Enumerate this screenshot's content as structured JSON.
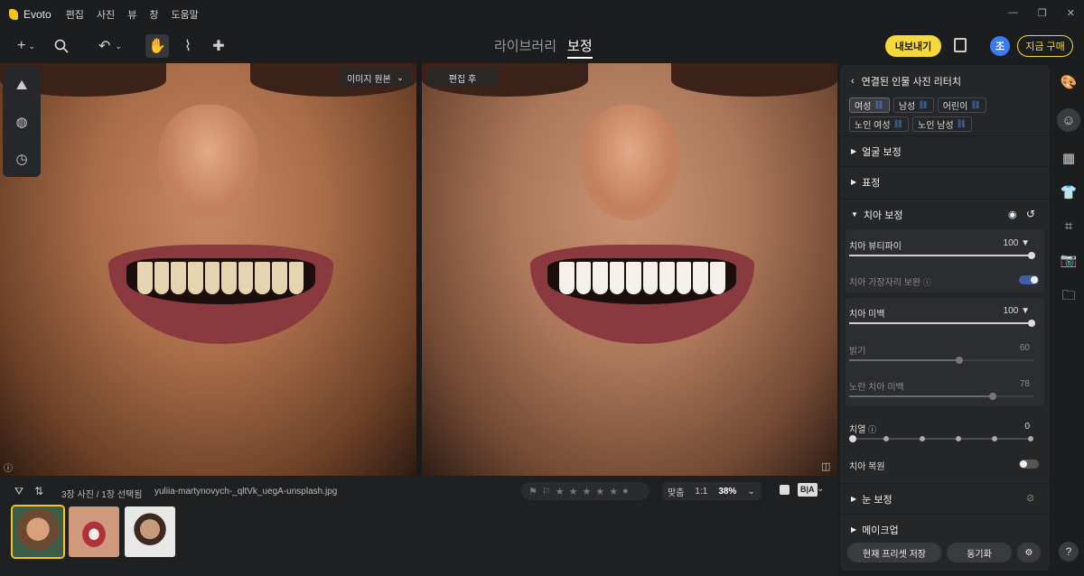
{
  "app": {
    "name": "Evoto"
  },
  "menu": [
    "편집",
    "사진",
    "뷰",
    "창",
    "도움말"
  ],
  "toolbar": {
    "tabs": [
      {
        "label": "라이브러리",
        "active": false
      },
      {
        "label": "보정",
        "active": true
      }
    ],
    "export_label": "내보내기",
    "avatar_letter": "조",
    "buy_label": "지금 구매"
  },
  "canvas": {
    "left_tag": "이미지 원본",
    "right_tag": "편집 후"
  },
  "filmstrip": {
    "count_text": "3장 사진 / 1장 선택됨",
    "filename": "yuliia-martynovych-_qltVk_uegA-unsplash.jpg",
    "zoom_fit": "맞춤",
    "zoom_1to1": "1:1",
    "zoom_value": "38%",
    "ab_label": "B|A"
  },
  "panel": {
    "header": "연결된 인물 사진 리터치",
    "chips": [
      {
        "label": "여성",
        "active": true
      },
      {
        "label": "남성",
        "active": false
      },
      {
        "label": "어린이",
        "active": false
      },
      {
        "label": "노인 여성",
        "active": false
      },
      {
        "label": "노인 남성",
        "active": false
      }
    ],
    "sections": {
      "face": "얼굴 보정",
      "expression": "표정",
      "teeth": "치아 보정",
      "eyes": "눈 보정",
      "makeup": "메이크업"
    },
    "teeth": {
      "beautify_label": "치아 뷰티파이",
      "beautify_value": "100",
      "edge_label": "치아 가장자리 보완",
      "edge_on": true,
      "whiten_label": "치아 미백",
      "whiten_value": "100",
      "brightness_label": "밝기",
      "brightness_value": "60",
      "yellow_label": "노란 치아 미백",
      "yellow_value": "78",
      "alignment_label": "치열",
      "alignment_value": "0",
      "restore_label": "치아 복원",
      "restore_on": false
    },
    "footer": {
      "save_preset": "현재 프리셋 저장",
      "sync": "동기화"
    }
  },
  "colors": {
    "accent": "#f5d93a",
    "avatar": "#3a7bf2",
    "toggle_on": "#3e5fa8"
  }
}
